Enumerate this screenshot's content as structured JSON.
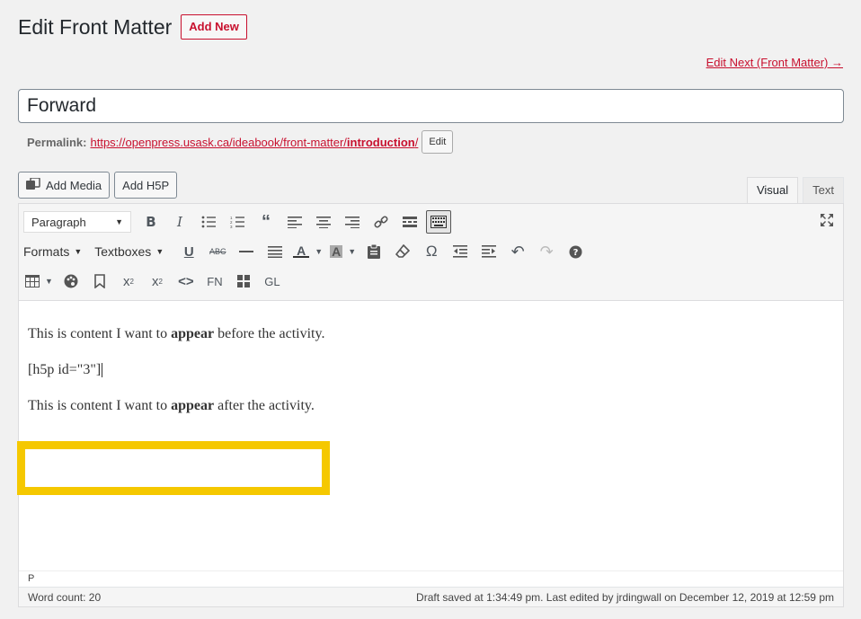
{
  "header": {
    "title": "Edit Front Matter",
    "add_new": "Add New",
    "edit_next": "Edit Next (Front Matter) →"
  },
  "post": {
    "title": "Forward",
    "permalink_label": "Permalink:",
    "permalink_base": "https://openpress.usask.ca/ideabook/front-matter/",
    "permalink_slug": "introduction",
    "permalink_end": "/",
    "edit_label": "Edit"
  },
  "media": {
    "add_media": "Add Media",
    "add_h5p": "Add H5P"
  },
  "tabs": {
    "visual": "Visual",
    "text": "Text"
  },
  "toolbar": {
    "format_select": "Paragraph",
    "formats_menu": "Formats",
    "textboxes_menu": "Textboxes",
    "footnote": "FN",
    "glossary": "GL",
    "icons": [
      "bold-icon",
      "italic-icon",
      "bullet-list-icon",
      "numbered-list-icon",
      "blockquote-icon",
      "align-left-icon",
      "align-center-icon",
      "align-right-icon",
      "link-icon",
      "read-more-icon",
      "toolbar-toggle-icon",
      "fullscreen-icon"
    ]
  },
  "content": {
    "p1_before": "This is content I want to ",
    "p1_bold": "appear",
    "p1_after": " before the activity.",
    "shortcode": "[h5p id=\"3\"]",
    "p3_before": "This is content I want to ",
    "p3_bold": "appear",
    "p3_after": " after the activity.",
    "highlight_color": "#f5c800"
  },
  "status": {
    "path": "P",
    "word_count": "Word count: 20",
    "saved": "Draft saved at 1:34:49 pm. Last edited by jrdingwall on December 12, 2019 at 12:59 pm"
  },
  "colors": {
    "accent": "#c8102e"
  }
}
